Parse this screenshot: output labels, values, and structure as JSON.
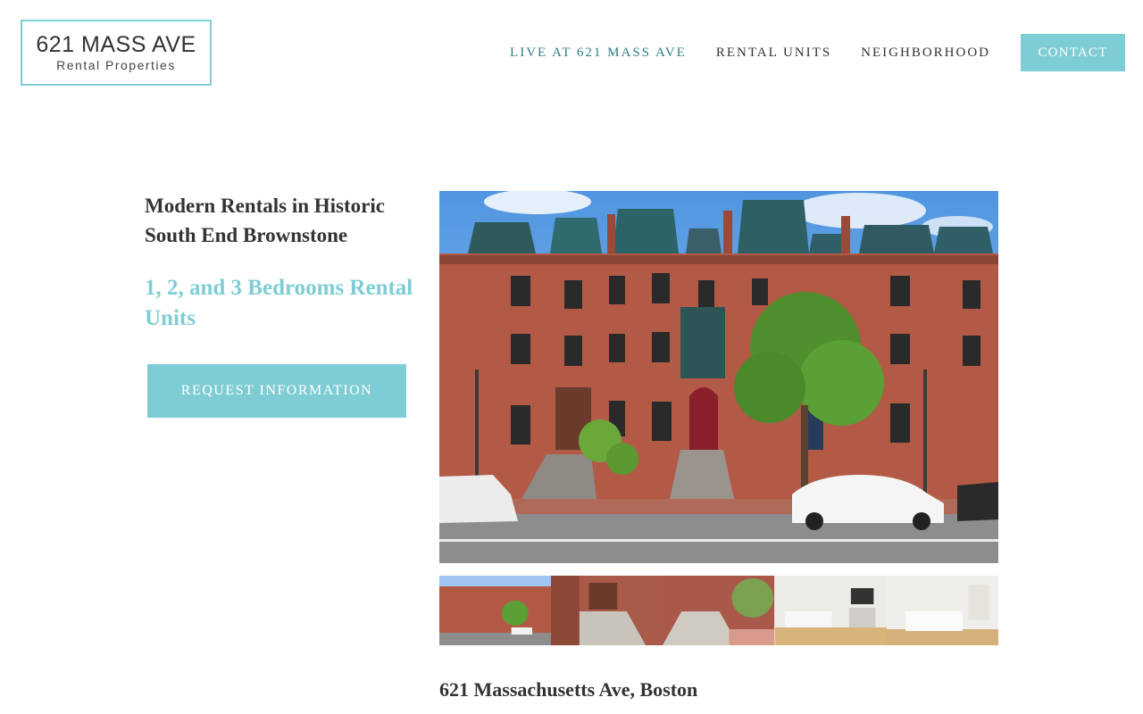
{
  "logo": {
    "title": "621 MASS AVE",
    "subtitle": "Rental Properties"
  },
  "nav": {
    "items": [
      "LIVE AT 621 MASS AVE",
      "RENTAL UNITS",
      "NEIGHBORHOOD"
    ],
    "contact": "CONTACT"
  },
  "hero": {
    "headline": "Modern Rentals in Historic South End Brownstone",
    "subhead": "1, 2, and 3 Bedrooms Rental Units",
    "cta": "REQUEST INFORMATION"
  },
  "address": "621 Massachusetts Ave, Boston",
  "colors": {
    "accent": "#7fcdd4",
    "nav_active": "#2f7c84",
    "text": "#333333"
  },
  "gallery": {
    "thumbnails": [
      "building-exterior",
      "front-stairs",
      "street-view",
      "living-room",
      "bedroom"
    ]
  }
}
